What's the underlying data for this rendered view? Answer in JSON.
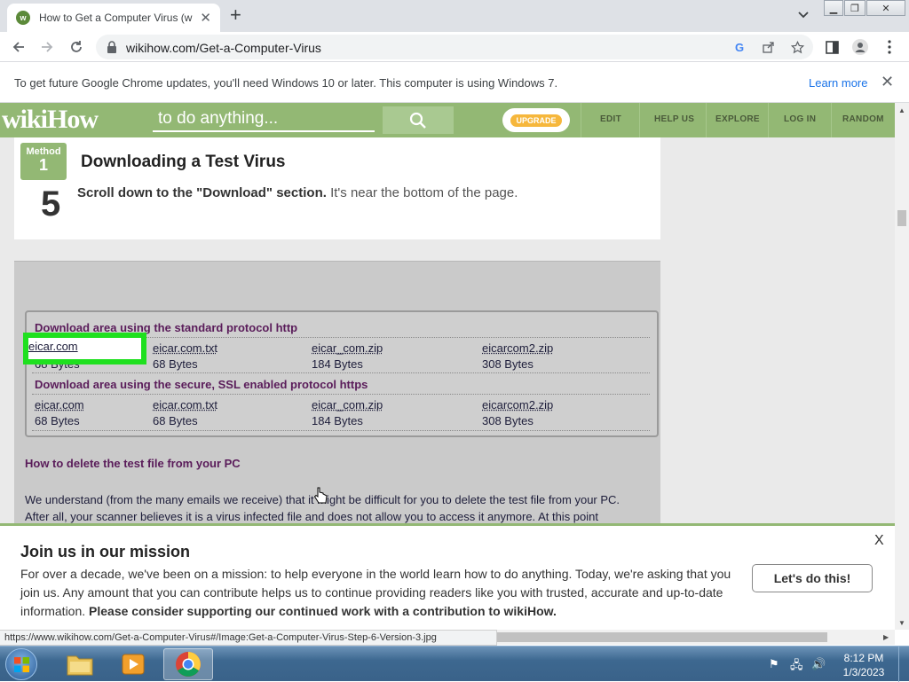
{
  "browser": {
    "tab_title": "How to Get a Computer Virus (w",
    "url": "wikihow.com/Get-a-Computer-Virus",
    "status_url": "https://www.wikihow.com/Get-a-Computer-Virus#/Image:Get-a-Computer-Virus-Step-6-Version-3.jpg"
  },
  "infobar": {
    "message": "To get future Google Chrome updates, you'll need Windows 10 or later. This computer is using Windows 7.",
    "learn_more": "Learn more"
  },
  "wikihow": {
    "logo_wiki": "wiki",
    "logo_how": "How",
    "search_placeholder": "to do anything...",
    "upgrade": "UPGRADE",
    "nav": [
      "EDIT",
      "HELP US",
      "EXPLORE",
      "LOG IN",
      "RANDOM"
    ]
  },
  "article": {
    "method_label": "Method",
    "method_number": "1",
    "method_title": "Downloading a Test Virus",
    "step_number": "5",
    "step_bold": "Scroll down to the \"Download\" section.",
    "step_rest": " It's near the bottom of the page."
  },
  "step_image": {
    "http_heading": "Download area using the standard protocol http",
    "https_heading": "Download area using the secure, SSL enabled protocol https",
    "files": [
      {
        "name": "eicar.com",
        "size": "68 Bytes"
      },
      {
        "name": "eicar.com.txt",
        "size": "68 Bytes"
      },
      {
        "name": "eicar_com.zip",
        "size": "184 Bytes"
      },
      {
        "name": "eicarcom2.zip",
        "size": "308 Bytes"
      }
    ],
    "highlighted_partial_size": "68 Bytes",
    "delete_heading": "How to delete the test file from your PC",
    "delete_para": "We understand (from the many emails we receive) that it might be difficult for you to delete the test file from your PC. After all, your scanner believes it is a virus infected file and does not allow you to access it anymore. At this point",
    "highlight_color": "#1fe01f"
  },
  "mission": {
    "heading": "Join us in our mission",
    "body_plain": "For over a decade, we've been on a mission: to help everyone in the world learn how to do anything. Today, we're asking that you join us. Any amount that you can contribute helps us to continue providing readers like you with trusted, accurate and up-to-date information. ",
    "body_bold": "Please consider supporting our continued work with a contribution to wikiHow.",
    "cta": "Let's do this!",
    "close": "X"
  },
  "taskbar": {
    "time": "8:12 PM",
    "date": "1/3/2023"
  },
  "colors": {
    "wikihow_green": "#93b874",
    "highlight_green": "#1fe01f",
    "link_blue": "#1a73e8",
    "heading_purple": "#5a1c5a"
  }
}
